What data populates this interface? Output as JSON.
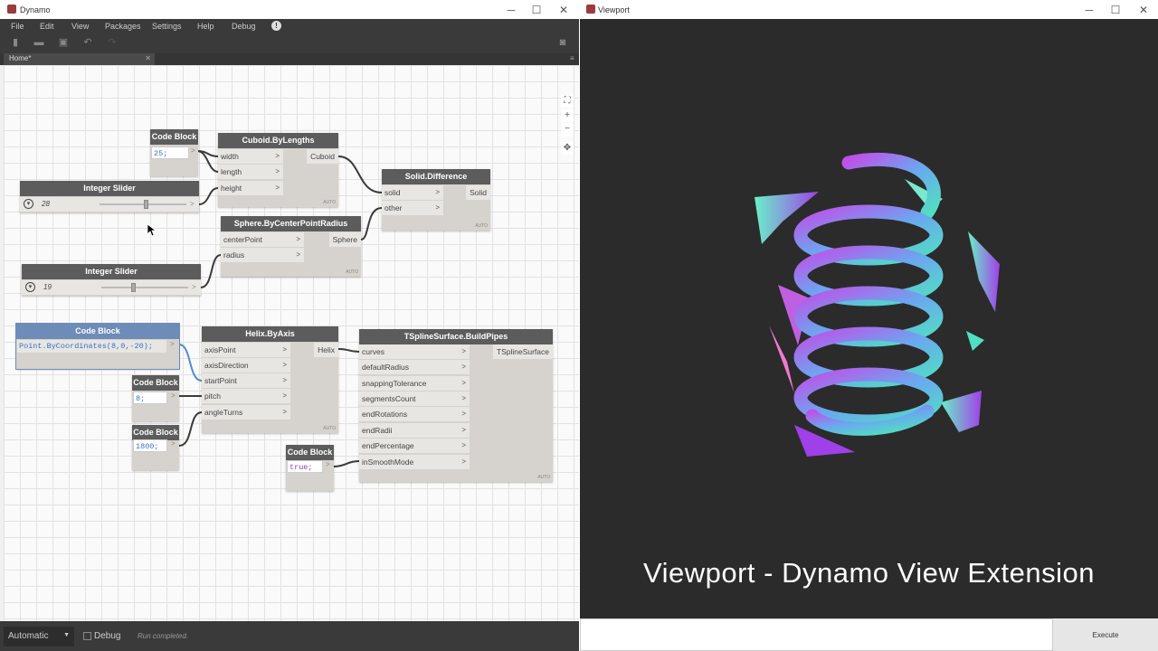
{
  "dynamo": {
    "title": "Dynamo",
    "menu": [
      "File",
      "Edit",
      "View",
      "Packages",
      "Settings",
      "Help",
      "Debug"
    ],
    "tab": "Home*",
    "run_mode": "Automatic",
    "debug_label": "Debug",
    "status": "Run completed."
  },
  "nodes": {
    "cb1": {
      "title": "Code Block",
      "value": "25;"
    },
    "cuboid": {
      "title": "Cuboid.ByLengths",
      "inputs": [
        "width",
        "length",
        "height"
      ],
      "output": "Cuboid",
      "lacing": "AUTO"
    },
    "slider1": {
      "title": "Integer Slider",
      "value": "28"
    },
    "solid": {
      "title": "Solid.Difference",
      "inputs": [
        "solid",
        "other"
      ],
      "output": "Solid",
      "lacing": "AUTO"
    },
    "sphere": {
      "title": "Sphere.ByCenterPointRadius",
      "inputs": [
        "centerPoint",
        "radius"
      ],
      "output": "Sphere",
      "lacing": "AUTO"
    },
    "slider2": {
      "title": "Integer Slider",
      "value": "19"
    },
    "cb2": {
      "title": "Code Block",
      "value": "Point.ByCoordinates(8,0,-20);"
    },
    "helix": {
      "title": "Helix.ByAxis",
      "inputs": [
        "axisPoint",
        "axisDirection",
        "startPoint",
        "pitch",
        "angleTurns"
      ],
      "output": "Helix",
      "lacing": "AUTO"
    },
    "cb3": {
      "title": "Code Block",
      "value": "8;"
    },
    "cb4": {
      "title": "Code Block",
      "value": "1800;"
    },
    "tspline": {
      "title": "TSplineSurface.BuildPipes",
      "inputs": [
        "curves",
        "defaultRadius",
        "snappingTolerance",
        "segmentsCount",
        "endRotations",
        "endRadii",
        "endPercentage",
        "inSmoothMode"
      ],
      "output": "TSplineSurface",
      "lacing": "AUTO"
    },
    "cb5": {
      "title": "Code Block",
      "value": "true;"
    }
  },
  "viewport": {
    "title": "Viewport",
    "caption": "Viewport - Dynamo View Extension",
    "execute_label": "Execute"
  }
}
